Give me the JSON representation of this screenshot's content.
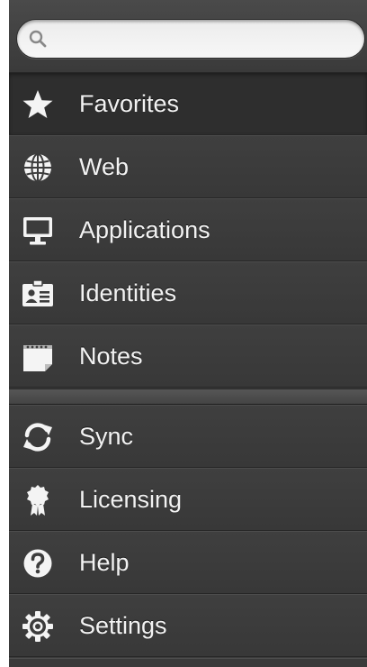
{
  "search": {
    "placeholder": "",
    "value": ""
  },
  "menu": {
    "primary": [
      {
        "label": "Favorites",
        "icon": "star-icon",
        "selected": true
      },
      {
        "label": "Web",
        "icon": "globe-icon",
        "selected": false
      },
      {
        "label": "Applications",
        "icon": "monitor-icon",
        "selected": false
      },
      {
        "label": "Identities",
        "icon": "id-card-icon",
        "selected": false
      },
      {
        "label": "Notes",
        "icon": "notepad-icon",
        "selected": false
      }
    ],
    "secondary": [
      {
        "label": "Sync",
        "icon": "sync-icon"
      },
      {
        "label": "Licensing",
        "icon": "ribbon-badge-icon"
      },
      {
        "label": "Help",
        "icon": "help-icon"
      },
      {
        "label": "Settings",
        "icon": "gear-icon"
      }
    ]
  },
  "colors": {
    "panel_background": "#3c3c3c",
    "selected_background": "#2e2e2e",
    "label_text": "#f2f2f2",
    "search_field": "#f2f2f2"
  }
}
